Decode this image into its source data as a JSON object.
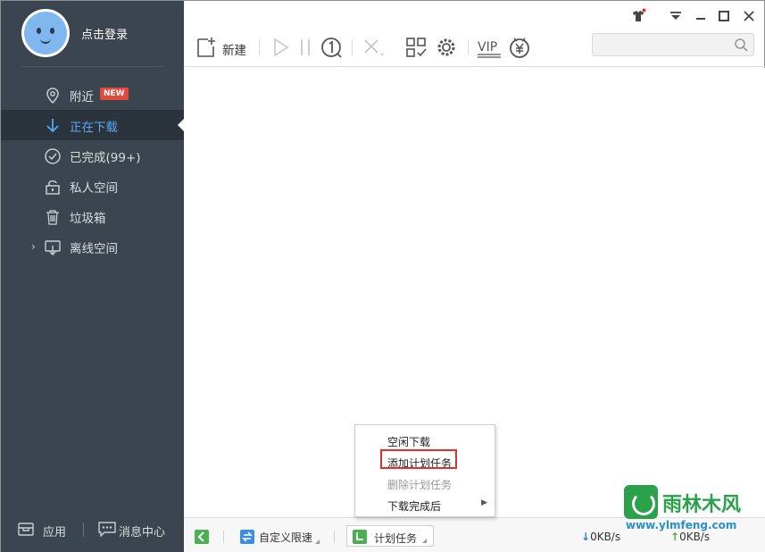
{
  "sidebar": {
    "login_text": "点击登录",
    "items": [
      {
        "label": "附近",
        "badge": "NEW",
        "icon": "location-pin-icon"
      },
      {
        "label": "正在下载",
        "icon": "download-arrow-icon",
        "active": true
      },
      {
        "label": "已完成(99+)",
        "icon": "check-circle-icon"
      },
      {
        "label": "私人空间",
        "icon": "lock-icon"
      },
      {
        "label": "垃圾箱",
        "icon": "trash-icon"
      },
      {
        "label": "离线空间",
        "icon": "cloud-download-icon"
      }
    ],
    "bottom": {
      "apps_label": "应用",
      "messages_label": "消息中心"
    }
  },
  "toolbar": {
    "new_label": "新建",
    "vip_label": "VIP",
    "search_placeholder": ""
  },
  "statusbar": {
    "speed_label": "自定义限速",
    "plan_label": "计划任务",
    "down_speed": "0KB/s",
    "up_speed": "0KB/s"
  },
  "context_menu": {
    "items": [
      {
        "label": "空闲下载"
      },
      {
        "label": "添加计划任务",
        "highlighted": true
      },
      {
        "label": "删除计划任务",
        "disabled": true
      },
      {
        "label": "下载完成后",
        "submenu": true
      }
    ]
  },
  "watermark": {
    "name": "雨林木风",
    "url": "www.ylmfeng.com"
  },
  "colors": {
    "sidebar_bg": "#3b4550",
    "active_bg": "#2b333c",
    "accent_blue": "#5aa8f0",
    "badge_red": "#e24a3b",
    "highlight_red": "#e03030",
    "green": "#4caf50"
  }
}
